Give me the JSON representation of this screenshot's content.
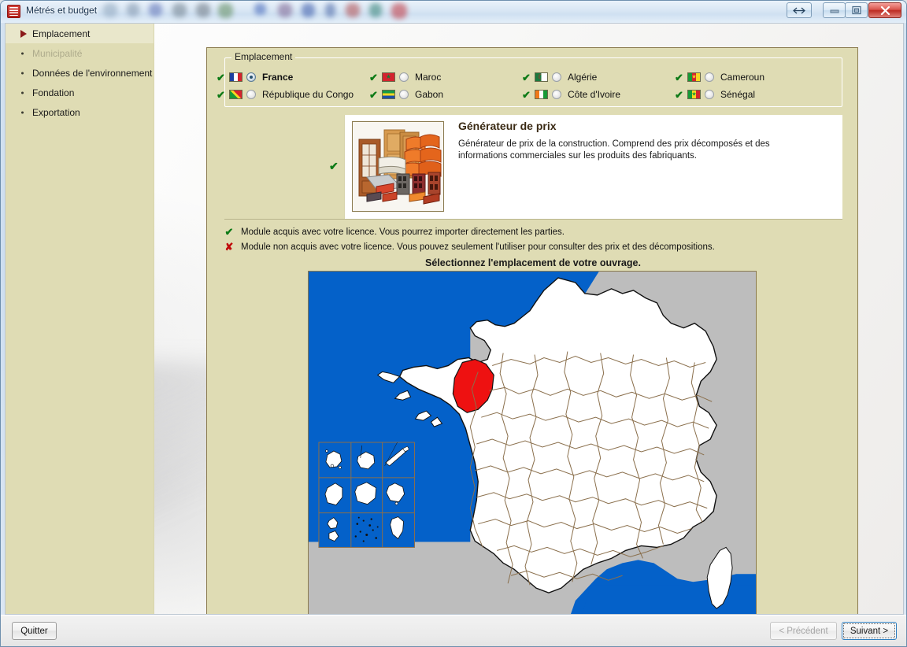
{
  "window": {
    "title": "Métrés et budget",
    "icon": "app-icon",
    "controls": {
      "restore_label": "⇔",
      "minimize_label": "—",
      "maximize_label": "❐",
      "close_label": "✕"
    }
  },
  "sidebar": {
    "items": [
      {
        "label": "Emplacement",
        "state": "active"
      },
      {
        "label": "Municipalité",
        "state": "disabled"
      },
      {
        "label": "Données de l'environnement",
        "state": "normal"
      },
      {
        "label": "Fondation",
        "state": "normal"
      },
      {
        "label": "Exportation",
        "state": "normal"
      }
    ]
  },
  "group": {
    "legend": "Emplacement",
    "countries": [
      {
        "name": "France",
        "flag": "fl-france",
        "licensed": true,
        "selected": true,
        "tick": "✔"
      },
      {
        "name": "Maroc",
        "flag": "fl-maroc",
        "licensed": true,
        "selected": false,
        "tick": "✔"
      },
      {
        "name": "Algérie",
        "flag": "fl-algerie",
        "licensed": true,
        "selected": false,
        "tick": "✔"
      },
      {
        "name": "Cameroun",
        "flag": "fl-cameroun",
        "licensed": true,
        "selected": false,
        "tick": "✔"
      },
      {
        "name": "République du Congo",
        "flag": "fl-congo",
        "licensed": true,
        "selected": false,
        "tick": "✔"
      },
      {
        "name": "Gabon",
        "flag": "fl-gabon",
        "licensed": true,
        "selected": false,
        "tick": "✔"
      },
      {
        "name": "Côte d'Ivoire",
        "flag": "fl-civ",
        "licensed": true,
        "selected": false,
        "tick": "✔"
      },
      {
        "name": "Sénégal",
        "flag": "fl-senegal",
        "licensed": true,
        "selected": false,
        "tick": "✔"
      }
    ]
  },
  "product": {
    "check": "✔",
    "title": "Générateur de prix",
    "description": "Générateur de prix de la construction. Comprend des prix décomposés et des informations commerciales sur les produits des fabriquants.",
    "thumbnail": "construction-materials-image"
  },
  "legend": {
    "ok_icon": "✔",
    "ok_text": "Module acquis avec votre licence. Vous pourrez importer directement les parties.",
    "no_icon": "✘",
    "no_text": "Module non acquis avec votre licence. Vous pouvez seulement l'utiliser pour consulter des prix et des décompositions."
  },
  "map": {
    "heading": "Sélectionnez l'emplacement de votre ouvrage.",
    "country": "France",
    "selected_region": "Ille-et-Vilaine",
    "colors": {
      "sea": "#0461c9",
      "land": "#ffffff",
      "neighbour": "#bdbdbd",
      "selected": "#ee1111",
      "border": "#8a6f4c"
    }
  },
  "footer": {
    "quit_label": "Quitter",
    "prev_label": "< Précédent",
    "next_label": "Suivant >"
  }
}
